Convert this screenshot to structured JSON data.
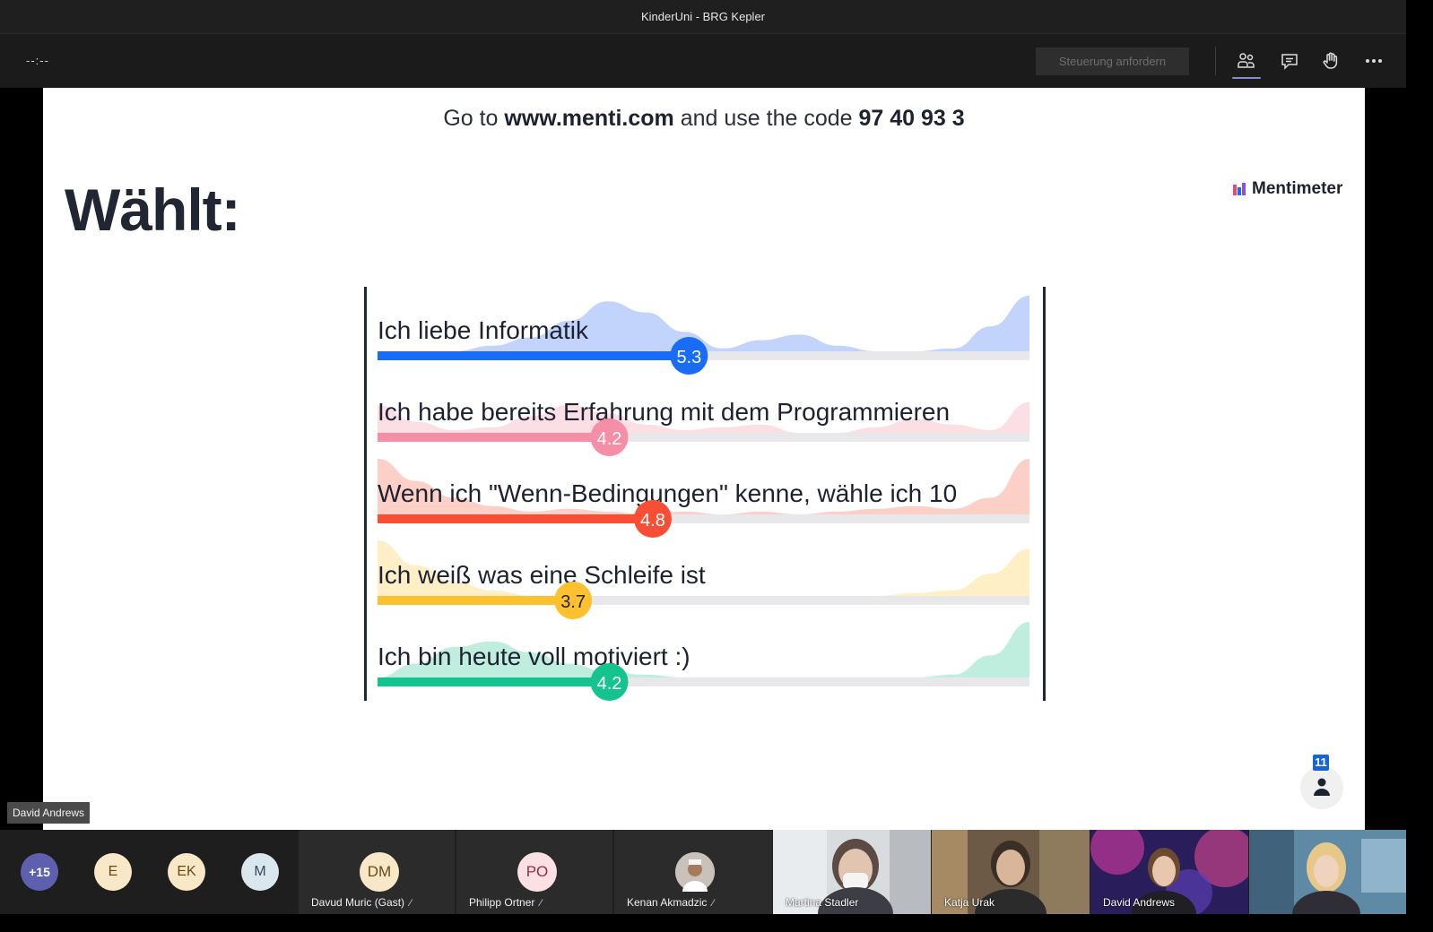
{
  "window": {
    "title": "KinderUni - BRG Kepler"
  },
  "toolbar": {
    "timer": "--:--",
    "request_control_label": "Steuerung anfordern",
    "icons": [
      "participants-icon",
      "chat-icon",
      "raise-hand-icon",
      "more-options-icon"
    ]
  },
  "slide": {
    "join_prefix": "Go to ",
    "join_url": "www.menti.com",
    "join_middle": " and use the code ",
    "join_code": "97 40 93 3",
    "heading": "Wählt:",
    "brand": "Mentimeter",
    "response_count": "11"
  },
  "chart_data": {
    "type": "bar",
    "orientation": "horizontal",
    "xlim": [
      1,
      10
    ],
    "categories": [
      "Ich liebe Informatik",
      "Ich habe bereits Erfahrung mit dem Programmieren",
      "Wenn ich \"Wenn-Bedingungen\" kenne, wähle ich 10",
      "Ich weiß was eine Schleife ist",
      "Ich bin heute voll motiviert :)"
    ],
    "values": [
      5.3,
      4.2,
      4.8,
      3.7,
      4.2
    ],
    "value_labels": [
      "5.3",
      "4.2",
      "4.8",
      "3.7",
      "4.2"
    ],
    "colors": [
      "#196cf5",
      "#f58ea6",
      "#f94e36",
      "#fdc02f",
      "#14c38e"
    ],
    "fill_colors": [
      "#b8cdfb",
      "#fcd8e0",
      "#fdc8bd",
      "#feecbd",
      "#b4ebd9"
    ],
    "track_color": "#e8e8ea"
  },
  "presenter_tag": "David Andrews",
  "gallery": {
    "overflow_count": "+15",
    "initials_avatars": [
      {
        "initials": "E",
        "bg": "#f9e8c7",
        "fg": "#6a4a12"
      },
      {
        "initials": "EK",
        "bg": "#f9e8c7",
        "fg": "#6a4a12"
      },
      {
        "initials": "M",
        "bg": "#dbe7ee",
        "fg": "#34495a"
      }
    ],
    "tiles": [
      {
        "name": "Davud Muric (Gast)",
        "initials": "DM",
        "bg": "#f9e8c7",
        "fg": "#6a4a12"
      },
      {
        "name": "Philipp Ortner",
        "initials": "PO",
        "bg": "#fbe0e4",
        "fg": "#9b2b3f"
      },
      {
        "name": "Kenan Akmadzic",
        "initials": "",
        "bg": "#d7d2cd",
        "fg": "#333333"
      }
    ],
    "video_tiles": [
      {
        "name": "Martina Stadler"
      },
      {
        "name": "Katja Urak"
      },
      {
        "name": "David Andrews"
      },
      {
        "name": ""
      }
    ]
  }
}
